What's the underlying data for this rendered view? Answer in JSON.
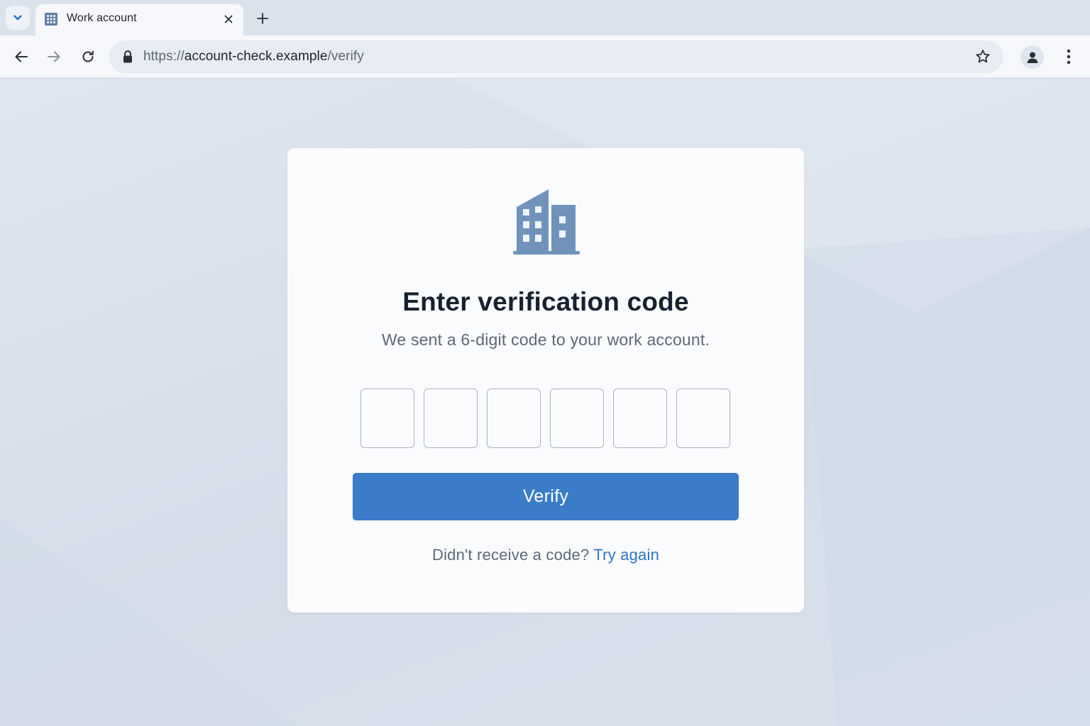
{
  "browser": {
    "tab": {
      "title": "Work account",
      "favicon": "building-grid-icon"
    },
    "tab_search_icon": "chevron-down-icon",
    "close_tab_icon": "close-icon",
    "new_tab_icon": "plus-icon",
    "toolbar": {
      "back_icon": "arrow-left-icon",
      "forward_icon": "arrow-right-icon",
      "reload_icon": "reload-icon",
      "bookmark_icon": "star-icon",
      "profile_icon": "person-icon",
      "menu_icon": "kebab-menu-icon"
    },
    "address": {
      "scheme": "https://",
      "host": "account-check.example",
      "path": "/verify",
      "security_icon": "lock-icon"
    }
  },
  "page": {
    "logo_icon": "office-building-icon",
    "title": "Enter verification code",
    "subtitle": "We sent a 6-digit code to your work account.",
    "code_digits": [
      "",
      "",
      "",
      "",
      "",
      ""
    ],
    "verify_label": "Verify",
    "resend_prompt": "Didn't receive a code?",
    "resend_link": "Try again"
  },
  "colors": {
    "accent": "#3a7cc7",
    "link": "#2f73c2",
    "logo": "#7193bb",
    "background": "#d6dfea"
  }
}
